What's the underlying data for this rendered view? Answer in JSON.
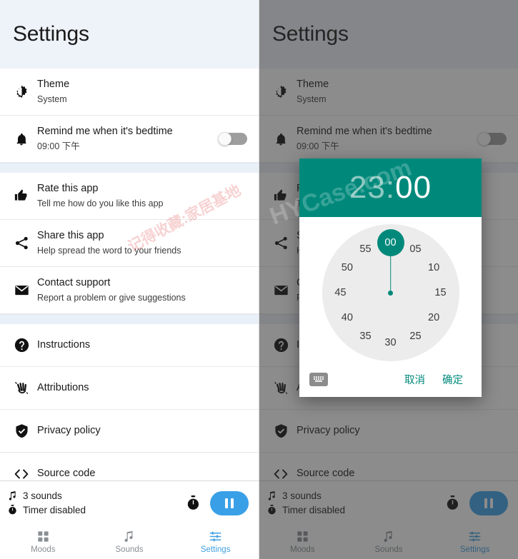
{
  "app": {
    "title": "Settings"
  },
  "settings": {
    "groups": [
      {
        "name": "appearance",
        "rows": [
          {
            "icon": "brightness-icon",
            "title": "Theme",
            "subtitle": "System",
            "control": "none"
          },
          {
            "icon": "bell-icon",
            "title": "Remind me when it's bedtime",
            "subtitle": "09:00 下午",
            "control": "switch",
            "switch_on": false
          }
        ]
      },
      {
        "name": "engagement",
        "rows": [
          {
            "icon": "thumbs-up-icon",
            "title": "Rate this app",
            "subtitle": "Tell me how do you like this app",
            "control": "none"
          },
          {
            "icon": "share-icon",
            "title": "Share this app",
            "subtitle": "Help spread the word to your friends",
            "control": "none"
          },
          {
            "icon": "mail-icon",
            "title": "Contact support",
            "subtitle": "Report a problem or give suggestions",
            "control": "none"
          }
        ]
      },
      {
        "name": "about",
        "rows": [
          {
            "icon": "question-icon",
            "title": "Instructions",
            "subtitle": "",
            "control": "none"
          },
          {
            "icon": "hands-clap-icon",
            "title": "Attributions",
            "subtitle": "",
            "control": "none"
          },
          {
            "icon": "shield-check-icon",
            "title": "Privacy policy",
            "subtitle": "",
            "control": "none"
          },
          {
            "icon": "code-brackets-icon",
            "title": "Source code",
            "subtitle": "",
            "control": "none"
          }
        ]
      }
    ]
  },
  "player": {
    "sounds_label": "3 sounds",
    "timer_label": "Timer disabled",
    "sounds_icon": "music-note-icon",
    "timer_icon": "stopwatch-icon",
    "timer_button_icon": "stopwatch-icon",
    "pause_button_icon": "pause-icon",
    "pause_color": "#39a0e8"
  },
  "tabbar": {
    "active_color": "#3f9fe0",
    "inactive_color": "#8a8f94",
    "tabs": [
      {
        "label": "Moods",
        "icon": "grid-icon",
        "active": false
      },
      {
        "label": "Sounds",
        "icon": "music-note-icon",
        "active": false
      },
      {
        "label": "Settings",
        "icon": "sliders-icon",
        "active": true
      }
    ]
  },
  "time_picker": {
    "accent": "#00897b",
    "hour": "23",
    "separator": ":",
    "minute": "00",
    "selected_field": "minute",
    "mode": "minutes",
    "selected_minute": "00",
    "ticks": [
      "00",
      "05",
      "10",
      "15",
      "20",
      "25",
      "30",
      "35",
      "40",
      "45",
      "50",
      "55"
    ],
    "keyboard_icon": "keyboard-icon",
    "cancel_label": "取消",
    "confirm_label": "确定"
  },
  "watermarks": {
    "red": "记得收藏:家居基地",
    "white": "HYCase.com"
  }
}
